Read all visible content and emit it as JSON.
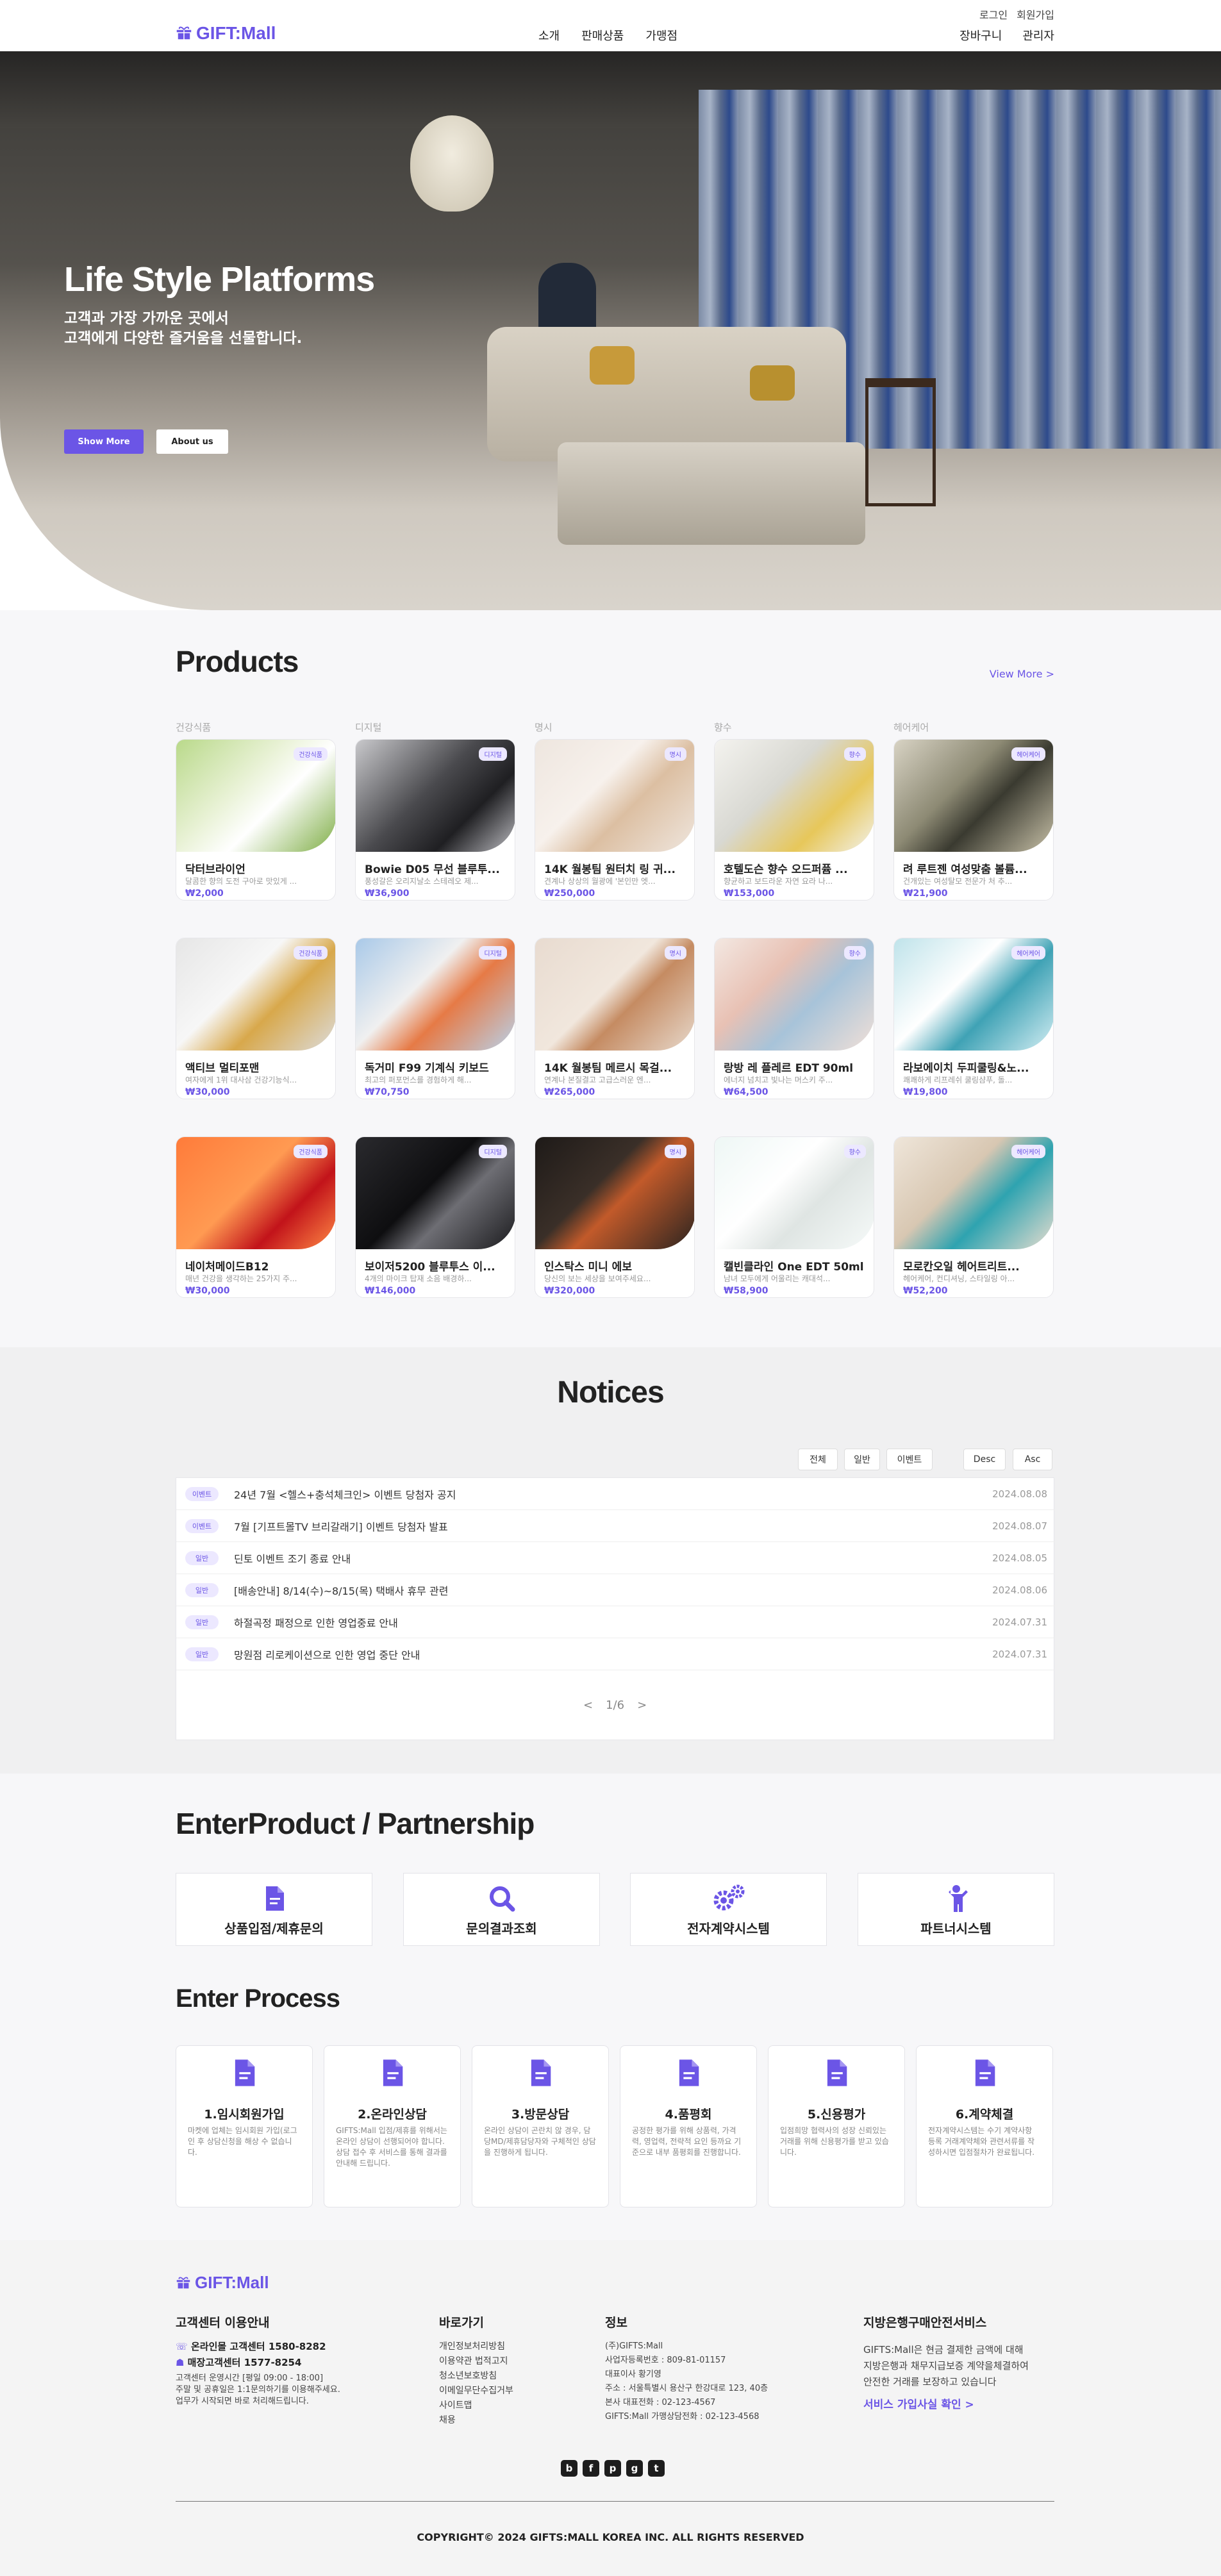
{
  "header": {
    "logo": "GIFT:Mall",
    "login": "로그인",
    "signup": "회원가입",
    "nav": [
      "소개",
      "판매상품",
      "가맹점"
    ],
    "cart": "장바구니",
    "admin": "관리자"
  },
  "hero": {
    "title": "Life Style Platforms",
    "line1": "고객과 가장 가까운 곳에서",
    "line2": "고객에게 다양한 즐거움을 선물합니다.",
    "btn_more": "Show More",
    "btn_about": "About us"
  },
  "products": {
    "title": "Products",
    "view_more": "View More >",
    "categories": [
      "건강식품",
      "디지털",
      "명시",
      "향수",
      "헤어케어"
    ],
    "items": [
      {
        "badge": "건강식품",
        "name": "닥터브라이언",
        "desc": "달콤한 향의 도전 구아로 맛있게 ...",
        "price": "₩2,000"
      },
      {
        "badge": "디지털",
        "name": "Bowie D05 무선 블루투...",
        "desc": "풍성갈은 오리지날소 스테레오 제...",
        "price": "₩36,900"
      },
      {
        "badge": "명시",
        "name": "14K 월봉팀 원터치 링 귀...",
        "desc": "견계나 상상의 월광에 '본인만 엣...",
        "price": "₩250,000"
      },
      {
        "badge": "향수",
        "name": "호텔도슨 향수 오드퍼퓸 ...",
        "desc": "향균하고 보드라운 자연 요라 나...",
        "price": "₩153,000"
      },
      {
        "badge": "헤어케어",
        "name": "려 루트젠 여성맞춤 볼륨...",
        "desc": "건개있는 여성탈모 전문가 처 추...",
        "price": "₩21,900"
      },
      {
        "badge": "건강식품",
        "name": "액티브 멀티포맨",
        "desc": "여자에게 1위 대사삼 건강기능식...",
        "price": "₩30,000"
      },
      {
        "badge": "디지털",
        "name": "독거미 F99 기계식 키보드",
        "desc": "최고의 퍼포먼스를 경험하게 해...",
        "price": "₩70,750"
      },
      {
        "badge": "명시",
        "name": "14K 월봉팀 메르시 목걸...",
        "desc": "연계나 본질결고 고급스러운 엔...",
        "price": "₩265,000"
      },
      {
        "badge": "향수",
        "name": "랑방 레 플레르 EDT 90ml",
        "desc": "에너지 넘치고 빛나는 머스키 주...",
        "price": "₩64,500"
      },
      {
        "badge": "헤어케어",
        "name": "라보에이치 두피쿨링&노...",
        "desc": "쾌쾌하게 리프레쉬 쿨링샴푸, 돌...",
        "price": "₩19,800"
      },
      {
        "badge": "건강식품",
        "name": "네이처메이드B12",
        "desc": "매년 건강을 생각하는 25가지 주...",
        "price": "₩30,000"
      },
      {
        "badge": "디지털",
        "name": "보이저5200 블루투스 이...",
        "desc": "4개의 마이크 탑재 소음 배경하...",
        "price": "₩146,000"
      },
      {
        "badge": "명시",
        "name": "인스탁스 미니 에보",
        "desc": "당신의 보는 세상을 보여주세요...",
        "price": "₩320,000"
      },
      {
        "badge": "향수",
        "name": "캘빈클라인 One EDT 50ml",
        "desc": "남녀 모두에게 어울리는 캐대석...",
        "price": "₩58,900"
      },
      {
        "badge": "헤어케어",
        "name": "모로칸오일 헤어트리트...",
        "desc": "헤어케어, 컨디셔닝, 스타일링 아...",
        "price": "₩52,200"
      }
    ]
  },
  "notices": {
    "title": "Notices",
    "filters": [
      "전체",
      "일반",
      "이벤트"
    ],
    "sorts": [
      "Desc",
      "Asc"
    ],
    "rows": [
      {
        "tag": "이벤트",
        "title": "24년 7월 <헬스+충석체크인> 이벤트 당첨자 공지",
        "date": "2024.08.08"
      },
      {
        "tag": "이벤트",
        "title": "7월 [기프트몰TV 브리갈래기] 이벤트 당첨자 발표",
        "date": "2024.08.07"
      },
      {
        "tag": "일반",
        "title": "딘토 이벤트 조기 종료 안내",
        "date": "2024.08.05"
      },
      {
        "tag": "일반",
        "title": "[배송안내] 8/14(수)~8/15(목) 택배사 휴무 관련",
        "date": "2024.08.06"
      },
      {
        "tag": "일반",
        "title": "하절곡정 패정으로 인한 영업중료 안내",
        "date": "2024.07.31"
      },
      {
        "tag": "일반",
        "title": "망원점 리로케이션으로 인한 영업 중단 안내",
        "date": "2024.07.31"
      }
    ],
    "pager": {
      "prev": "<",
      "page": "1/6",
      "next": ">"
    }
  },
  "partnership": {
    "title": "EnterProduct / Partnership",
    "boxes": [
      "상품입점/제휴문의",
      "문의결과조회",
      "전자계약시스템",
      "파트너시스템"
    ]
  },
  "process": {
    "title": "Enter Process",
    "steps": [
      {
        "title": "1.임시회원가입",
        "desc": "마켓에 업체는 임시회원 가입(로그인 후 상담신청을 해상 수 없습니다."
      },
      {
        "title": "2.온라인상담",
        "desc": "GIFTS:Mall 입점/제휴를 위해서는 온라인 상담이 선행되어야 합니다. 상담 접수 후 서비스를 통해 결과를 안내해 드립니다."
      },
      {
        "title": "3.방문상담",
        "desc": "온라인 상담이 곤란치 않 경우, 담당MD/제휴담당자와 구체적인 상담을 진행하게 됩니다."
      },
      {
        "title": "4.품평회",
        "desc": "공정한 평가를 위해 상품력, 가격력, 영업력, 전략적 요인 등까요 기준으로 내부 품평회를 진행합니다."
      },
      {
        "title": "5.신용평가",
        "desc": "입점희망 협력사의 성장 신뢰있는 거래를 위해 신용평가를 받고 있습니다."
      },
      {
        "title": "6.계약체결",
        "desc": "전자계약시스템는 수기 계약사항 등록 거래계약체와 관련서류를 작성하시면 입점절차가 완료됩니다."
      }
    ]
  },
  "footer": {
    "logo": "GIFT:Mall",
    "cs": {
      "title": "고객센터 이용안내",
      "online": "온라인몰 고객센터 1580-8282",
      "store": "매장고객센터 1577-8254",
      "hours": "고객센터 운영시간 [평일 09:00 - 18:00]",
      "note1": "주말 및 공휴일은 1:1문의하기를 이용해주세요.",
      "note2": "업무가 시작되면 바로 처리해드립니다."
    },
    "links": {
      "title": "바로가기",
      "items": [
        "개인정보처리방침",
        "이용약관 법적고지",
        "청소년보호방침",
        "이메일무단수집거부",
        "사이트맵",
        "채용"
      ]
    },
    "info": {
      "title": "정보",
      "items": [
        "(주)GIFTS:Mall",
        "사업자등록번호 : 809-81-01157",
        "대표이사 황기영",
        "주소 : 서울특별시 용산구 한강대로 123, 40층",
        "본사 대표전화 : 02-123-4567",
        "GIFTS:Mall 가맹상담전화 : 02-123-4568"
      ]
    },
    "bank": {
      "title": "지방은행구매안전서비스",
      "text1": "GIFTS:Mall은 현금 결제한 금액에 대해",
      "text2": "지방은행과 채무지급보증 계약을체결하여",
      "text3": "안전한 거래를 보장하고 있습니다",
      "link": "서비스 가입사실 확인 >"
    },
    "social": [
      "b",
      "f",
      "p",
      "g",
      "t"
    ],
    "copyright": "COPYRIGHT© 2024 GIFTS:MALL KOREA INC. ALL RIGHTS RESERVED"
  },
  "colors": {
    "accent": "#6b55e6",
    "badge_bg": "#ece8ff"
  }
}
